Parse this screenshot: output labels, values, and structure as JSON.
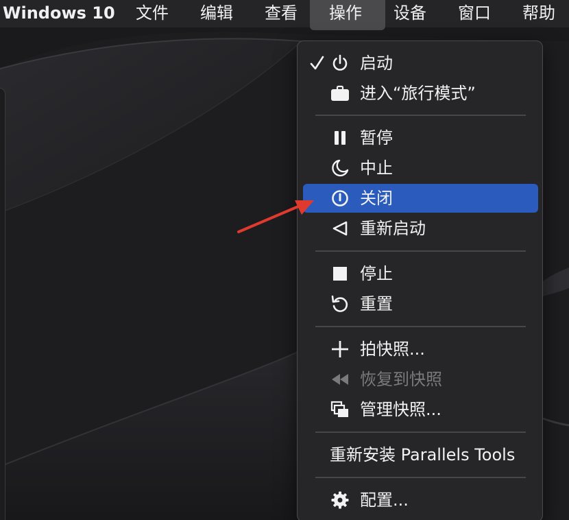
{
  "menubar": {
    "app_name": "Windows 10",
    "items": [
      {
        "label": "文件"
      },
      {
        "label": "编辑"
      },
      {
        "label": "查看"
      },
      {
        "label": "操作"
      },
      {
        "label": "设备"
      },
      {
        "label": "窗口"
      },
      {
        "label": "帮助"
      }
    ],
    "active_item": "操作"
  },
  "actions_menu": {
    "items": [
      {
        "label": "启动",
        "icon": "power-icon",
        "checked": true
      },
      {
        "label": "进入“旅行模式”",
        "icon": "briefcase-icon"
      },
      {
        "label": "暂停",
        "icon": "pause-icon"
      },
      {
        "label": "中止",
        "icon": "moon-icon"
      },
      {
        "label": "关闭",
        "icon": "shutdown-icon",
        "highlighted": true
      },
      {
        "label": "重新启动",
        "icon": "restart-triangle-icon"
      },
      {
        "label": "停止",
        "icon": "stop-square-icon"
      },
      {
        "label": "重置",
        "icon": "reset-arrow-icon"
      },
      {
        "label": "拍快照...",
        "icon": "plus-icon"
      },
      {
        "label": "恢复到快照",
        "icon": "rewind-icon",
        "disabled": true
      },
      {
        "label": "管理快照...",
        "icon": "stacked-windows-icon"
      },
      {
        "label": "重新安装 Parallels Tools"
      },
      {
        "label": "配置...",
        "icon": "gear-icon"
      }
    ]
  },
  "colors": {
    "menubar_bg": "#252527",
    "menu_bg": "#262628",
    "highlight": "#2a5bbd",
    "annotation_arrow": "#e03a2f"
  }
}
